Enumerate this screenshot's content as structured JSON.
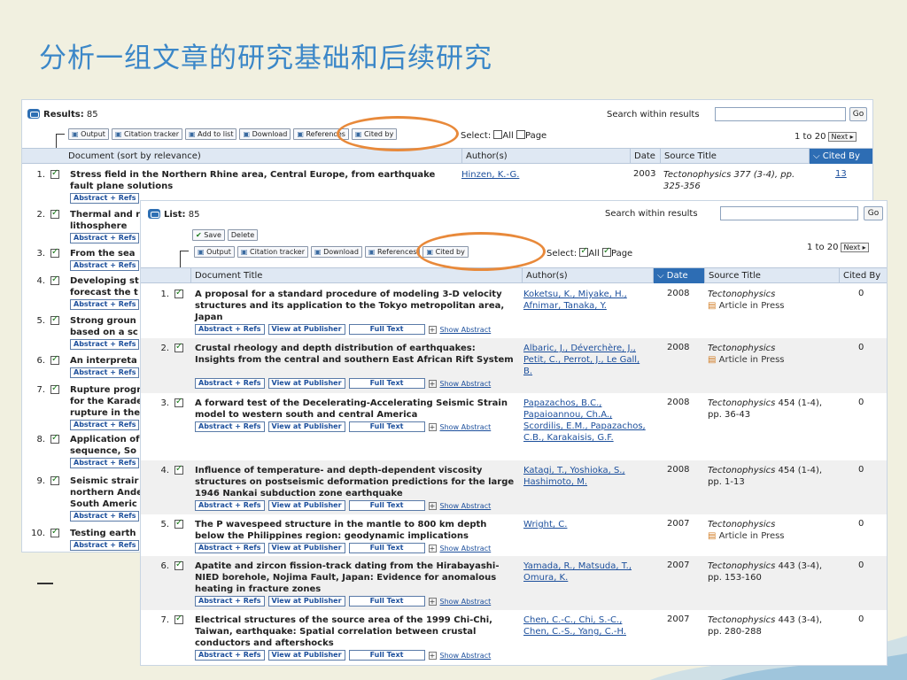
{
  "slide": {
    "title": "分析一组文章的研究基础和后续研究"
  },
  "colors": {
    "accent": "#2d6db4",
    "ring": "#e8893a",
    "title": "#3b87c8"
  },
  "back": {
    "label": "Results:",
    "count": "85",
    "search_within": "Search within results",
    "go": "Go",
    "toolbar": [
      "Output",
      "Citation tracker",
      "Add to list",
      "Download",
      "References",
      "Cited by"
    ],
    "select": "Select:",
    "all": "All",
    "page": "Page",
    "pager": "1 to 20",
    "next": "Next",
    "columns": [
      "Document (sort by relevance)",
      "Author(s)",
      "Date",
      "Source Title",
      "Cited By"
    ],
    "rows": [
      {
        "num": "1.",
        "title": "Stress field in the Northern Rhine area, Central Europe, from earthquake fault plane solutions",
        "authors": "Hinzen, K.-G.",
        "date": "2003",
        "source": "Tectonophysics 377 (3-4), pp. 325-356",
        "cited": "13"
      },
      {
        "num": "2.",
        "title": "Thermal and r",
        "title2": "lithosphere"
      },
      {
        "num": "3.",
        "title": "From the sea"
      },
      {
        "num": "4.",
        "title": "Developing st",
        "title2": "forecast the t"
      },
      {
        "num": "5.",
        "title": "Strong groun",
        "title2": "based on a sc"
      },
      {
        "num": "6.",
        "title": "An interpreta"
      },
      {
        "num": "7.",
        "title": "Rupture progr",
        "title2": "for the Karade",
        "title3": "rupture in the"
      },
      {
        "num": "8.",
        "title": "Application of",
        "title2": "sequence, So"
      },
      {
        "num": "9.",
        "title": "Seismic strair",
        "title2": "northern Ande",
        "title3": "South Americ"
      },
      {
        "num": "10.",
        "title": "Testing earth"
      }
    ],
    "abstract_refs": "Abstract + Refs"
  },
  "front": {
    "label": "List:",
    "count": "85",
    "search_within": "Search within results",
    "go": "Go",
    "save": "Save",
    "delete": "Delete",
    "toolbar": [
      "Output",
      "Citation tracker",
      "Download",
      "References",
      "Cited by"
    ],
    "select": "Select:",
    "all": "All",
    "page": "Page",
    "pager": "1 to 20",
    "next": "Next",
    "columns": [
      "Document Title",
      "Author(s)",
      "Date",
      "Source Title",
      "Cited By"
    ],
    "actions": {
      "abstract": "Abstract + Refs",
      "publisher": "View at Publisher",
      "fulltext": "Full Text",
      "show_abstract": "Show Abstract"
    },
    "rows": [
      {
        "num": "1.",
        "title": "A proposal for a standard procedure of modeling 3-D velocity structures and its application to the Tokyo metropolitan area, Japan",
        "authors": "Koketsu, K., Miyake, H., Afnimar, Tanaka, Y.",
        "date": "2008",
        "journal": "Tectonophysics",
        "src_rest": "",
        "aip": "Article in Press",
        "cited": "0"
      },
      {
        "num": "2.",
        "title": "Crustal rheology and depth distribution of earthquakes: Insights from the central and southern East African Rift System",
        "authors": "Albaric, J., Déverchère, J., Petit, C., Perrot, J., Le Gall, B.",
        "date": "2008",
        "journal": "Tectonophysics",
        "src_rest": "",
        "aip": "Article in Press",
        "cited": "0"
      },
      {
        "num": "3.",
        "title": "A forward test of the Decelerating-Accelerating Seismic Strain model to western south and central America",
        "authors": "Papazachos, B.C., Papaioannou, Ch.A., Scordilis, E.M., Papazachos, C.B., Karakaisis, G.F.",
        "date": "2008",
        "journal": "Tectonophysics",
        "src_rest": " 454 (1-4), pp. 36-43",
        "aip": "",
        "cited": "0"
      },
      {
        "num": "4.",
        "title": "Influence of temperature- and depth-dependent viscosity structures on postseismic deformation predictions for the large 1946 Nankai subduction zone earthquake",
        "authors": "Katagi, T., Yoshioka, S., Hashimoto, M.",
        "date": "2008",
        "journal": "Tectonophysics",
        "src_rest": " 454 (1-4), pp. 1-13",
        "aip": "",
        "cited": "0"
      },
      {
        "num": "5.",
        "title": "The P wavespeed structure in the mantle to 800 km depth below the Philippines region: geodynamic implications",
        "authors": "Wright, C.",
        "date": "2007",
        "journal": "Tectonophysics",
        "src_rest": "",
        "aip": "Article in Press",
        "cited": "0"
      },
      {
        "num": "6.",
        "title": "Apatite and zircon fission-track dating from the Hirabayashi-NIED borehole, Nojima Fault, Japan: Evidence for anomalous heating in fracture zones",
        "authors": "Yamada, R., Matsuda, T., Omura, K.",
        "date": "2007",
        "journal": "Tectonophysics",
        "src_rest": " 443 (3-4), pp. 153-160",
        "aip": "",
        "cited": "0"
      },
      {
        "num": "7.",
        "title": "Electrical structures of the source area of the 1999 Chi-Chi, Taiwan, earthquake: Spatial correlation between crustal conductors and aftershocks",
        "authors": "Chen, C.-C., Chi, S.-C., Chen, C.-S., Yang, C.-H.",
        "date": "2007",
        "journal": "Tectonophysics",
        "src_rest": " 443 (3-4), pp. 280-288",
        "aip": "",
        "cited": "0"
      }
    ]
  }
}
